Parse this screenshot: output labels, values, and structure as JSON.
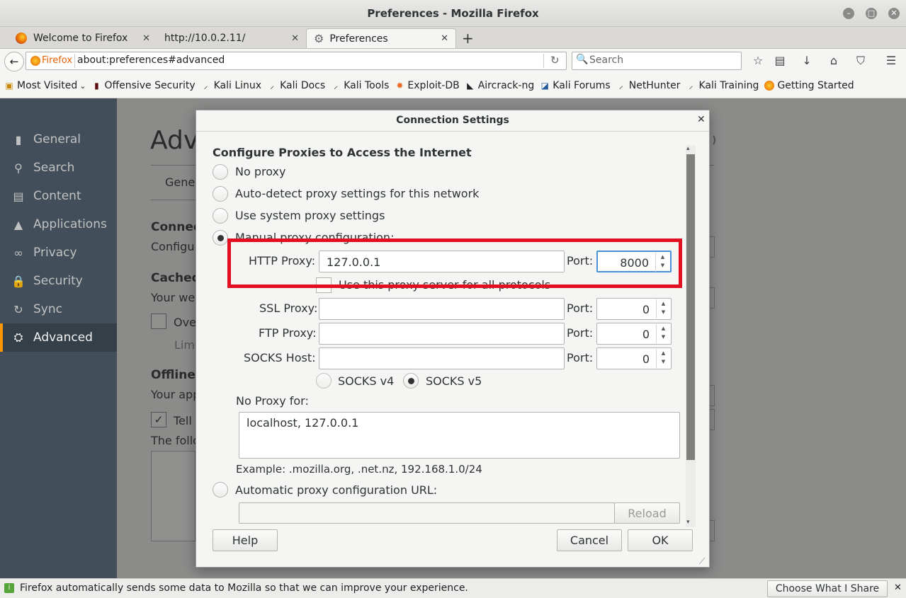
{
  "window": {
    "title": "Preferences - Mozilla Firefox"
  },
  "tabs": [
    {
      "label": "Welcome to Firefox"
    },
    {
      "label": "http://10.0.2.11/"
    },
    {
      "label": "Preferences"
    }
  ],
  "urlbar": {
    "identity": "Firefox",
    "url": "about:preferences#advanced"
  },
  "search": {
    "placeholder": "Search"
  },
  "bookmarks": [
    "Most Visited",
    "Offensive Security",
    "Kali Linux",
    "Kali Docs",
    "Kali Tools",
    "Exploit-DB",
    "Aircrack-ng",
    "Kali Forums",
    "NetHunter",
    "Kali Training",
    "Getting Started"
  ],
  "sidebar": {
    "items": [
      "General",
      "Search",
      "Content",
      "Applications",
      "Privacy",
      "Security",
      "Sync",
      "Advanced"
    ],
    "active": "Advanced"
  },
  "background_page": {
    "heading": "Adva",
    "tab_general": "Gene",
    "connection": "Connec",
    "configure": "Configu",
    "cached": "Cached",
    "your_we": "Your we",
    "override": "Ove",
    "limit": "Limi",
    "offline": "Offline",
    "your_app": "Your app",
    "tell": "Tell",
    "following": "The follo"
  },
  "dialog": {
    "title": "Connection Settings",
    "section_heading": "Configure Proxies to Access the Internet",
    "options": {
      "no_proxy": "No proxy",
      "auto_detect": "Auto-detect proxy settings for this network",
      "system": "Use system proxy settings",
      "manual": "Manual proxy configuration:",
      "auto_url": "Automatic proxy configuration URL:"
    },
    "selected_option": "manual",
    "http_proxy": {
      "label": "HTTP Proxy:",
      "value": "127.0.0.1",
      "port_label": "Port:",
      "port": "8000"
    },
    "share_all": {
      "label": "Use this proxy server for all protocols",
      "checked": false
    },
    "ssl_proxy": {
      "label": "SSL Proxy:",
      "value": "",
      "port_label": "Port:",
      "port": "0"
    },
    "ftp_proxy": {
      "label": "FTP Proxy:",
      "value": "",
      "port_label": "Port:",
      "port": "0"
    },
    "socks_host": {
      "label": "SOCKS Host:",
      "value": "",
      "port_label": "Port:",
      "port": "0"
    },
    "socks_v4": "SOCKS v4",
    "socks_v5": "SOCKS v5",
    "socks_selected": "v5",
    "no_proxy_for": {
      "label": "No Proxy for:",
      "value": "localhost, 127.0.0.1"
    },
    "example": "Example: .mozilla.org, .net.nz, 192.168.1.0/24",
    "auto_url_value": "",
    "reload_label": "Reload",
    "help_label": "Help",
    "cancel_label": "Cancel",
    "ok_label": "OK"
  },
  "notification": {
    "text": "Firefox automatically sends some data to Mozilla so that we can improve your experience.",
    "button": "Choose What I Share"
  },
  "colors": {
    "highlight_box": "#e10f1f",
    "sidebar_bg": "#424f5a",
    "sidebar_accent": "#ff9500"
  }
}
